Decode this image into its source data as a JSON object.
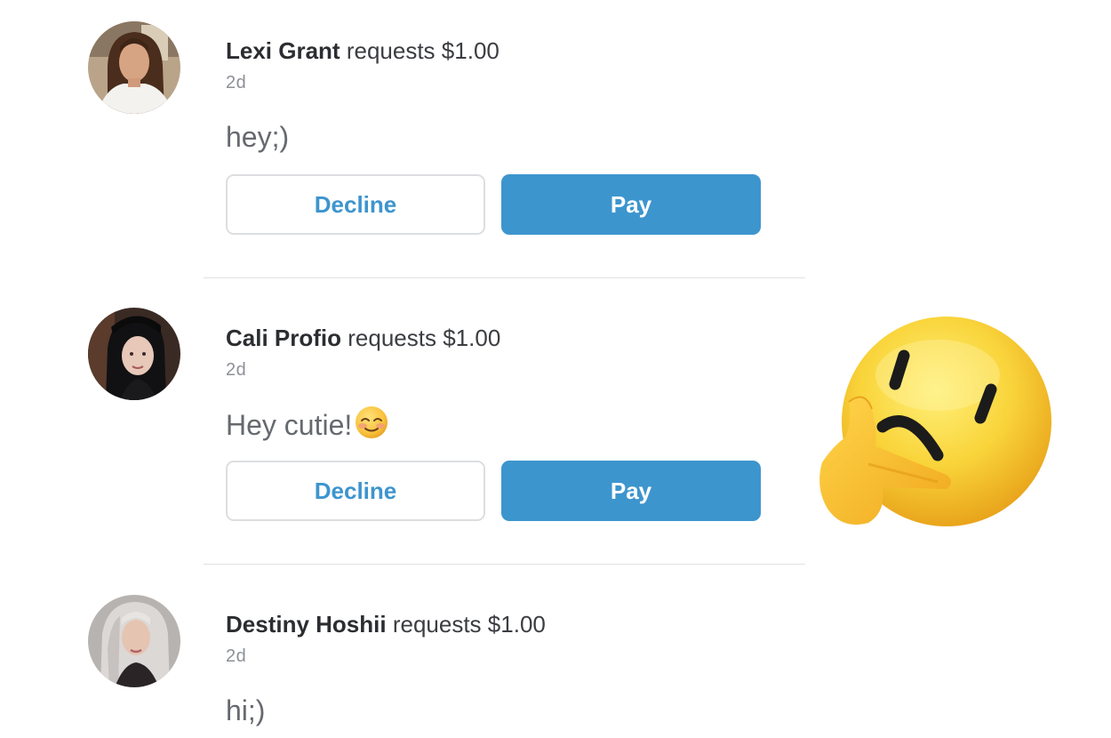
{
  "requests": [
    {
      "name": "Lexi Grant",
      "verb": "requests",
      "amount": "$1.00",
      "time": "2d",
      "note": "hey;)",
      "note_emoji": "",
      "decline_label": "Decline",
      "pay_label": "Pay"
    },
    {
      "name": "Cali Profio",
      "verb": "requests",
      "amount": "$1.00",
      "time": "2d",
      "note": "Hey cutie!",
      "note_emoji": "smiling-face-icon",
      "decline_label": "Decline",
      "pay_label": "Pay"
    },
    {
      "name": "Destiny Hoshii",
      "verb": "requests",
      "amount": "$1.00",
      "time": "2d",
      "note": "hi;)",
      "note_emoji": ""
    }
  ],
  "overlay": {
    "icon": "thinking-face-icon"
  },
  "colors": {
    "accent": "#3d95ce",
    "divider": "#dfe1e4",
    "text": "#2f3033",
    "muted": "#8d9096"
  }
}
